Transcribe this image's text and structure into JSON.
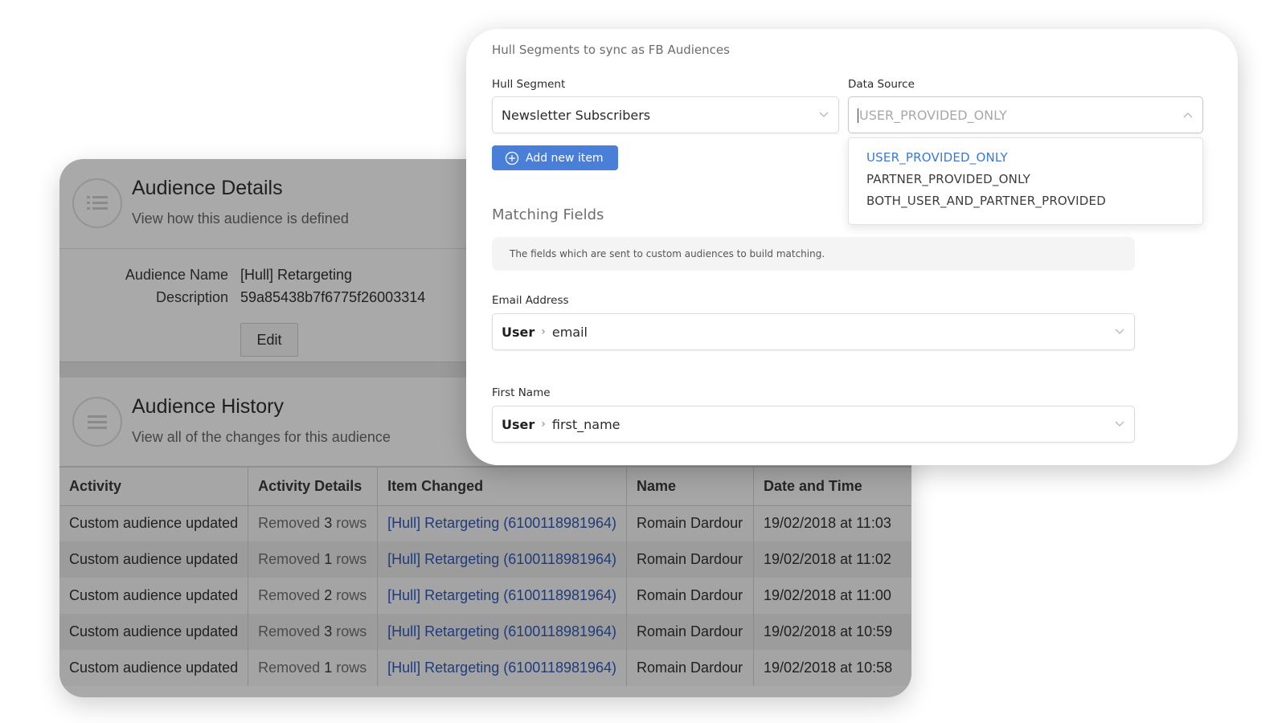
{
  "audience_details": {
    "title": "Audience Details",
    "subtitle": "View how this audience is defined",
    "icon": "list-icon",
    "name_label": "Audience Name",
    "name_value": "[Hull] Retargeting",
    "description_label": "Description",
    "description_value": "59a85438b7f6775f26003314",
    "edit_label": "Edit"
  },
  "audience_history": {
    "title": "Audience History",
    "subtitle": "View all of the changes for this audience",
    "icon": "list-icon",
    "columns": [
      "Activity",
      "Activity Details",
      "Item Changed",
      "Name",
      "Date and Time"
    ],
    "rows": [
      {
        "activity": "Custom audience updated",
        "details_prefix": "Removed",
        "details_count": "3",
        "details_suffix": "rows",
        "item": "[Hull] Retargeting (6100118981964)",
        "name": "Romain Dardour",
        "datetime": "19/02/2018 at 11:03"
      },
      {
        "activity": "Custom audience updated",
        "details_prefix": "Removed",
        "details_count": "1",
        "details_suffix": "rows",
        "item": "[Hull] Retargeting (6100118981964)",
        "name": "Romain Dardour",
        "datetime": "19/02/2018 at 11:02"
      },
      {
        "activity": "Custom audience updated",
        "details_prefix": "Removed",
        "details_count": "2",
        "details_suffix": "rows",
        "item": "[Hull] Retargeting (6100118981964)",
        "name": "Romain Dardour",
        "datetime": "19/02/2018 at 11:00"
      },
      {
        "activity": "Custom audience updated",
        "details_prefix": "Removed",
        "details_count": "3",
        "details_suffix": "rows",
        "item": "[Hull] Retargeting (6100118981964)",
        "name": "Romain Dardour",
        "datetime": "19/02/2018 at 10:59"
      },
      {
        "activity": "Custom audience updated",
        "details_prefix": "Removed",
        "details_count": "1",
        "details_suffix": "rows",
        "item": "[Hull] Retargeting (6100118981964)",
        "name": "Romain Dardour",
        "datetime": "19/02/2018 at 10:58"
      }
    ]
  },
  "settings": {
    "title": "Hull Segments to sync as FB Audiences",
    "hull_segment_label": "Hull Segment",
    "hull_segment_value": "Newsletter Subscribers",
    "data_source_label": "Data Source",
    "data_source_placeholder": "USER_PROVIDED_ONLY",
    "data_source_options": [
      "USER_PROVIDED_ONLY",
      "PARTNER_PROVIDED_ONLY",
      "BOTH_USER_AND_PARTNER_PROVIDED"
    ],
    "add_item_label": "Add new item",
    "matching_title": "Matching Fields",
    "matching_help": "The fields which are sent to custom audiences to build matching.",
    "email_label": "Email Address",
    "email_entity": "User",
    "email_field": "email",
    "first_name_label": "First Name",
    "first_name_entity": "User",
    "first_name_field": "first_name"
  },
  "colors": {
    "accent": "#4a7fd9",
    "selected_option": "#3a78d6",
    "link": "#1f3b7a"
  }
}
